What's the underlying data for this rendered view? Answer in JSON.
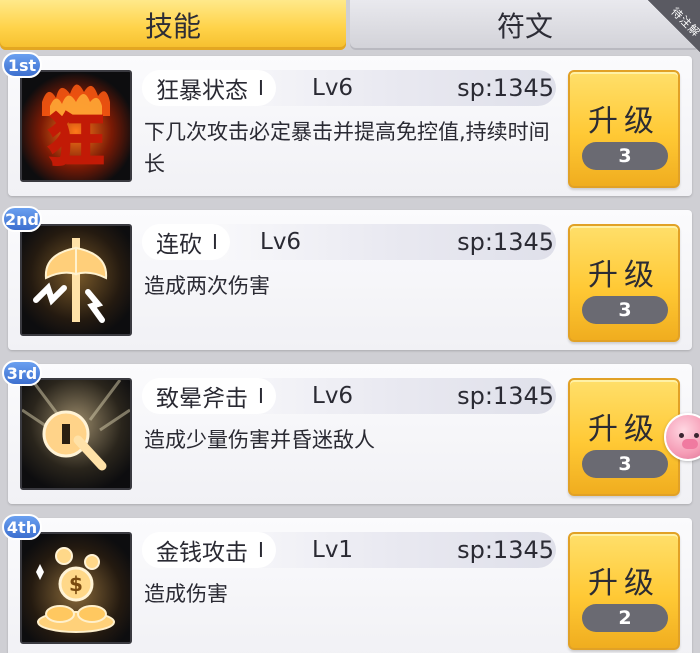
{
  "tabs": {
    "active": "技能",
    "inactive": "符文",
    "corner_badge": "待注解"
  },
  "skills": [
    {
      "rank": "1st",
      "name": "狂暴状态",
      "roman": "I",
      "level": "Lv6",
      "sp": "sp:1345",
      "description": "下几次攻击必定暴击并提高免控值,持续时间长",
      "upgrade_label": "升级",
      "cost": "3",
      "icon": "berserk-icon"
    },
    {
      "rank": "2nd",
      "name": "连砍",
      "roman": "I",
      "level": "Lv6",
      "sp": "sp:1345",
      "description": "造成两次伤害",
      "upgrade_label": "升级",
      "cost": "3",
      "icon": "double-axe-icon"
    },
    {
      "rank": "3rd",
      "name": "致晕斧击",
      "roman": "I",
      "level": "Lv6",
      "sp": "sp:1345",
      "description": "造成少量伤害并昏迷敌人",
      "upgrade_label": "升级",
      "cost": "3",
      "icon": "stun-axe-icon"
    },
    {
      "rank": "4th",
      "name": "金钱攻击",
      "roman": "I",
      "level": "Lv1",
      "sp": "sp:1345",
      "description": "造成伤害",
      "upgrade_label": "升级",
      "cost": "2",
      "icon": "coins-icon"
    }
  ]
}
